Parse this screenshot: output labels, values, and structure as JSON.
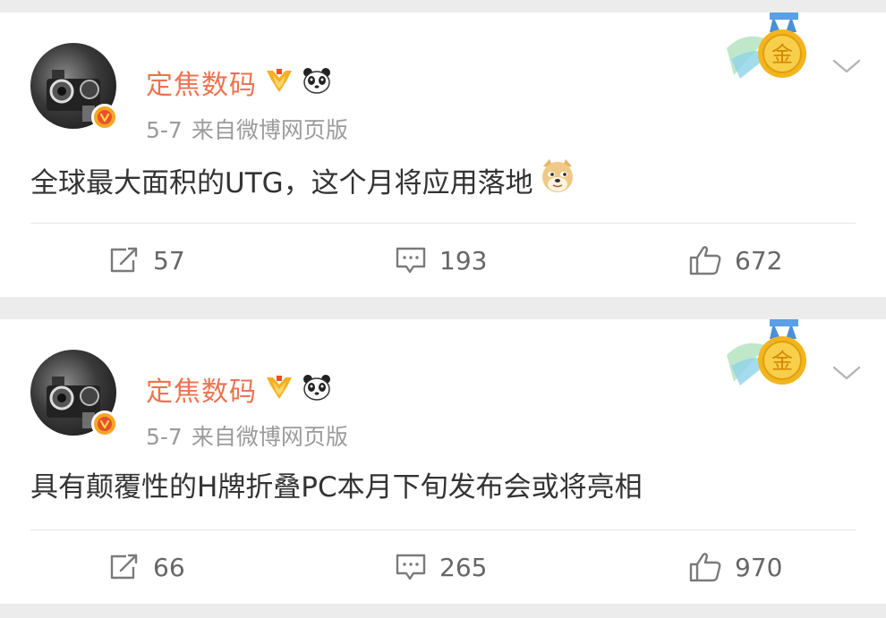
{
  "colors": {
    "background": "#ececec",
    "card": "#ffffff",
    "username": "#eb7350",
    "meta": "#9b9b9b",
    "text": "#333333",
    "action": "#666666",
    "verified_badge": "#f6a623"
  },
  "posts": [
    {
      "username": "定焦数码",
      "badges": [
        "vip-medal-icon",
        "panda-icon"
      ],
      "date": "5-7",
      "source": "来自微博网页版",
      "text": "全球最大面积的UTG，这个月将应用落地",
      "emoji": "doge-emoji-icon",
      "medal": "金",
      "reposts": "57",
      "comments": "193",
      "likes": "672"
    },
    {
      "username": "定焦数码",
      "badges": [
        "vip-medal-icon",
        "panda-icon"
      ],
      "date": "5-7",
      "source": "来自微博网页版",
      "text": "具有颠覆性的H牌折叠PC本月下旬发布会或将亮相",
      "emoji": "",
      "medal": "金",
      "reposts": "66",
      "comments": "265",
      "likes": "970"
    }
  ]
}
